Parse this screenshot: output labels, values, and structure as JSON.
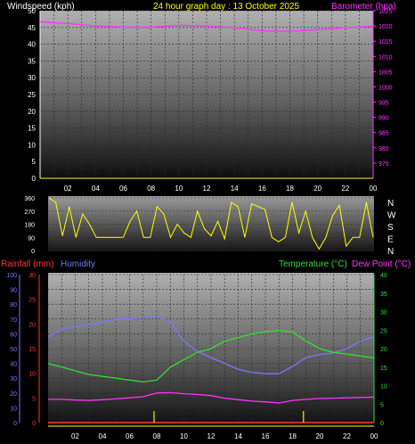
{
  "header": {
    "left_label": "Windspeed (kph)",
    "title": "24 hour graph day : 13 October 2025",
    "right_label": "Barometer (hpa)"
  },
  "colors": {
    "windspeed": "#ffffff",
    "barometer": "#ff33ff",
    "title": "#ffff00",
    "wind_direction": "#ffff00",
    "rainfall": "#ff3333",
    "humidity": "#7777ff",
    "temperature": "#33dd33",
    "dew_point": "#ff33ff",
    "hour_ticks": "#ffff00",
    "rain_event": "#cccc00"
  },
  "x_ticks": [
    "02",
    "04",
    "06",
    "08",
    "10",
    "12",
    "14",
    "16",
    "18",
    "20",
    "22",
    "00"
  ],
  "chart_data": [
    {
      "type": "line",
      "title": "24 hour graph day : 13 October 2025",
      "x": [
        0,
        2,
        4,
        6,
        8,
        10,
        12,
        14,
        16,
        18,
        20,
        22,
        24
      ],
      "left_axis": {
        "label": "Windspeed (kph)",
        "range": [
          0,
          50
        ],
        "ticks": [
          0,
          5,
          10,
          15,
          20,
          25,
          30,
          35,
          40,
          45,
          50
        ]
      },
      "right_axis": {
        "label": "Barometer (hpa)",
        "range": [
          970,
          1025
        ],
        "ticks": [
          975,
          980,
          985,
          990,
          995,
          1000,
          1005,
          1010,
          1015,
          1020,
          1025
        ]
      },
      "series": [
        {
          "name": "Barometer (hpa)",
          "axis": "right",
          "values": [
            1021.3,
            1020.8,
            1020.0,
            1019.6,
            1019.6,
            1020.2,
            1020.0,
            1019.4,
            1018.4,
            1018.2,
            1018.8,
            1019.4,
            1019.9
          ]
        }
      ],
      "grid": true
    },
    {
      "type": "line",
      "x_range": [
        0,
        24
      ],
      "left_axis": {
        "range": [
          0,
          360
        ],
        "ticks": [
          0,
          90,
          180,
          270,
          360
        ]
      },
      "right_labels": [
        "N",
        "W",
        "S",
        "E",
        "N"
      ],
      "series": [
        {
          "name": "Wind direction",
          "values": [
            360,
            330,
            100,
            300,
            90,
            250,
            180,
            90,
            90,
            90,
            90,
            90,
            200,
            270,
            90,
            90,
            300,
            250,
            90,
            180,
            120,
            90,
            270,
            150,
            100,
            200,
            80,
            330,
            300,
            90,
            320,
            300,
            280,
            90,
            60,
            90,
            330,
            120,
            270,
            90,
            10,
            90,
            240,
            310,
            30,
            90,
            90,
            330,
            90
          ]
        }
      ],
      "grid": true
    },
    {
      "type": "line",
      "x": [
        0,
        1,
        2,
        3,
        4,
        5,
        6,
        7,
        8,
        9,
        10,
        11,
        12,
        13,
        14,
        15,
        16,
        17,
        18,
        19,
        20,
        21,
        22,
        23,
        24
      ],
      "axes": [
        {
          "label": "Humidity",
          "range": [
            0,
            100
          ],
          "ticks": [
            0,
            10,
            20,
            30,
            40,
            50,
            60,
            70,
            80,
            90,
            100
          ]
        },
        {
          "label": "Rainfall (mm)",
          "range": [
            0,
            30
          ],
          "ticks": [
            0,
            5,
            10,
            15,
            20,
            25,
            30
          ]
        },
        {
          "label": "Temperature (°C)",
          "range": [
            0,
            40
          ],
          "ticks": [
            0,
            5,
            10,
            15,
            20,
            25,
            30,
            35,
            40
          ]
        },
        {
          "label": "Dew Point (°C)"
        }
      ],
      "series": [
        {
          "name": "Humidity",
          "axis": "Humidity",
          "values": [
            58,
            63,
            65,
            66,
            68,
            70,
            70,
            71,
            72,
            68,
            55,
            48,
            44,
            40,
            36,
            34,
            33,
            33,
            38,
            44,
            46,
            47,
            50,
            55,
            58
          ]
        },
        {
          "name": "Temperature (°C)",
          "axis": "Temperature (°C)",
          "values": [
            16,
            15,
            14,
            13,
            12.5,
            12,
            11.5,
            11,
            11.5,
            15,
            17,
            19,
            20,
            22,
            23,
            24,
            24.5,
            25,
            24.5,
            22,
            20,
            19,
            18.5,
            18,
            17.5
          ]
        },
        {
          "name": "Dew Point (°C)",
          "axis": "Temperature (°C)",
          "values": [
            6.3,
            6.3,
            6.1,
            6.0,
            6.2,
            6.4,
            6.7,
            7.0,
            8.0,
            8.1,
            7.8,
            7.6,
            7.3,
            6.6,
            6.2,
            5.8,
            5.6,
            5.3,
            6.0,
            6.3,
            6.5,
            6.6,
            6.7,
            6.8,
            6.9
          ]
        },
        {
          "name": "Rainfall (mm)",
          "axis": "Rainfall (mm)",
          "values": [
            0,
            0,
            0,
            0,
            0,
            0,
            0,
            0,
            0,
            0,
            0,
            0,
            0,
            0,
            0,
            0,
            0,
            0,
            0,
            0,
            0,
            0,
            0,
            0,
            0
          ]
        }
      ],
      "rain_events_hour": [
        7.8,
        18.8
      ],
      "grid": true
    }
  ]
}
